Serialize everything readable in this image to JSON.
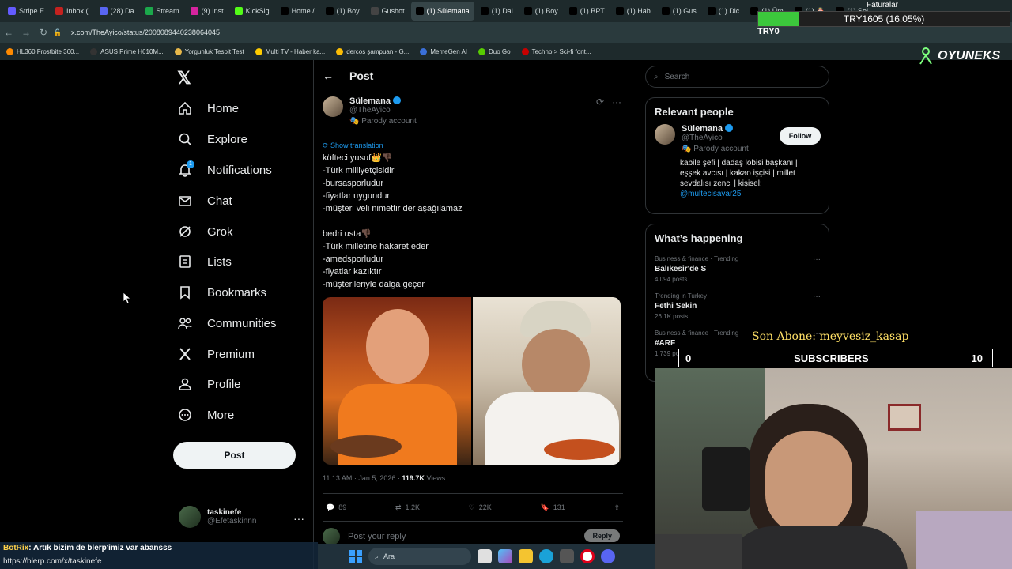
{
  "browser": {
    "tabs": [
      {
        "label": "Stripe E",
        "color": "#635bff",
        "active": false
      },
      {
        "label": "Inbox (",
        "color": "#c5221f",
        "active": false
      },
      {
        "label": "(28) Da",
        "color": "#5865f2",
        "active": false
      },
      {
        "label": "Stream",
        "color": "#1ba84b",
        "active": false
      },
      {
        "label": "(9) Inst",
        "color": "#d6249f",
        "active": false
      },
      {
        "label": "KickSig",
        "color": "#53fc18",
        "active": false
      },
      {
        "label": "Home /",
        "color": "#000000",
        "active": false
      },
      {
        "label": "(1) Boy",
        "color": "#000000",
        "active": false
      },
      {
        "label": "Gushot",
        "color": "#444444",
        "active": false
      },
      {
        "label": "(1) Sülemana",
        "color": "#000000",
        "active": true
      },
      {
        "label": "(1) Dai",
        "color": "#000000",
        "active": false
      },
      {
        "label": "(1) Boy",
        "color": "#000000",
        "active": false
      },
      {
        "label": "(1) BPT",
        "color": "#000000",
        "active": false
      },
      {
        "label": "(1) Hab",
        "color": "#000000",
        "active": false
      },
      {
        "label": "(1) Gus",
        "color": "#000000",
        "active": false
      },
      {
        "label": "(1) Dic",
        "color": "#000000",
        "active": false
      },
      {
        "label": "(1) Üm",
        "color": "#000000",
        "active": false
      },
      {
        "label": "(1) 🎂",
        "color": "#000000",
        "active": false
      },
      {
        "label": "(1) Sol",
        "color": "#000000",
        "active": false
      }
    ],
    "url": "x.com/TheAyico/status/2008089440238064045",
    "bookmarks": [
      "HL360 Frostbite 360...",
      "ASUS Prime H610M...",
      "Yorgunluk Tespit Test",
      "Multi TV - Haber ka...",
      "dercos şampuan - G...",
      "MemeGen AI",
      "Duo Go",
      "Techno > Sci-fi font..."
    ]
  },
  "overlay": {
    "try_text": "TRY1605 (16.05%)",
    "try_progress": 0.1605,
    "try_label": "TRY0",
    "faturalar": "Faturalar",
    "brand": "OYUNEKS",
    "son_abone": "Son Abone: meyvesiz_kasap",
    "subs_left": "0",
    "subs_label": "SUBSCRIBERS",
    "subs_right": "10",
    "chat_user": "BotRix",
    "chat_message": ": Artık bizim de blerp'imiz var abansss",
    "chat_link": "https://blerp.com/x/taskinefe"
  },
  "nav": {
    "items": [
      {
        "label": "Home",
        "icon": "home-icon"
      },
      {
        "label": "Explore",
        "icon": "search-icon"
      },
      {
        "label": "Notifications",
        "icon": "bell-icon"
      },
      {
        "label": "Chat",
        "icon": "mail-icon"
      },
      {
        "label": "Grok",
        "icon": "grok-icon"
      },
      {
        "label": "Lists",
        "icon": "list-icon"
      },
      {
        "label": "Bookmarks",
        "icon": "bookmark-icon"
      },
      {
        "label": "Communities",
        "icon": "people-icon"
      },
      {
        "label": "Premium",
        "icon": "x-icon"
      },
      {
        "label": "Profile",
        "icon": "user-icon"
      },
      {
        "label": "More",
        "icon": "more-icon"
      }
    ],
    "notif_count": "1",
    "post_button": "Post",
    "me_name": "taskinefe",
    "me_handle": "@Efetaskinnn"
  },
  "post": {
    "header": "Post",
    "author_name": "Sülemana",
    "author_handle": "@TheAyico",
    "parody_label": "Parody account",
    "show_translation": "Show translation",
    "body": "köfteci yusuf👑👎🏿\n-Türk milliyetçisidir\n-bursasporludur\n-fiyatlar uygundur\n-müşteri veli nimettir der aşağılamaz\n\nbedri usta👎🏿\n-Türk milletine hakaret eder\n-amedsporludur\n-fiyatlar kazıktır\n-müşterileriyle dalga geçer",
    "time": "11:13 AM · Jan 5, 2026 · ",
    "views": "119.7K",
    "views_label": " Views",
    "replies": "89",
    "reposts": "1.2K",
    "likes": "22K",
    "bookmarks": "131",
    "reply_placeholder": "Post your reply",
    "reply_button": "Reply"
  },
  "sidebar": {
    "search_placeholder": "Search",
    "relevant_title": "Relevant people",
    "rp_name": "Sülemana",
    "rp_handle": "@TheAyico",
    "rp_parody": "Parody account",
    "follow_label": "Follow",
    "rp_bio": "kabile şefi | dadaş lobisi başkanı | eşşek avcısı | kakao işçisi | millet sevdalısı zenci | kişisel: ",
    "rp_mention": "@multecisavar25",
    "happening_title": "What’s happening",
    "trends": [
      {
        "category": "Business & finance · Trending",
        "name": "Balıkesir'de S",
        "count": "4,094 posts"
      },
      {
        "category": "Trending in Turkey",
        "name": "Fethi Sekin",
        "count": "26.1K posts"
      },
      {
        "category": "Business & finance · Trending",
        "name": "#ARF",
        "count": "1,739 posts"
      }
    ]
  },
  "taskbar": {
    "search_label": "Ara"
  }
}
